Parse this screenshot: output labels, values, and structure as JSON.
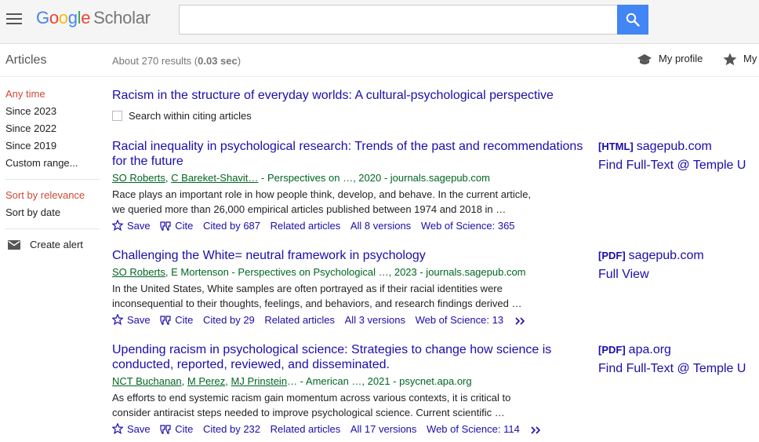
{
  "header": {
    "logo_letters": [
      "G",
      "o",
      "o",
      "g",
      "l",
      "e"
    ],
    "logo_product": "Scholar",
    "search_value": "",
    "colors": {
      "blue": "#4285f4",
      "red": "#ea4335",
      "yellow": "#fbbc05",
      "green": "#34a853"
    }
  },
  "subheader": {
    "section": "Articles",
    "results_prefix": "About 270 results (",
    "results_time": "0.03 sec",
    "results_suffix": ")",
    "my_profile": "My profile",
    "my_library": "My"
  },
  "sidebar": {
    "time_filters": [
      "Any time",
      "Since 2023",
      "Since 2022",
      "Since 2019",
      "Custom range..."
    ],
    "sort_options": [
      "Sort by relevance",
      "Sort by date"
    ],
    "create_alert": "Create alert",
    "active_color": "#d14836"
  },
  "cited": {
    "title": "Racism in the structure of everyday worlds: A cultural-psychological perspective",
    "search_within": "Search within citing articles"
  },
  "results": [
    {
      "title": "Racial inequality in psychological research: Trends of the past and recommendations for the future",
      "authors": [
        "SO Roberts",
        "C Bareket-Shavit…"
      ],
      "source": " - Perspectives on …, 2020 - journals.sagepub.com",
      "snippet": "Race plays an important role in how people think, develop, and behave. In the current article, we queried more than 26,000 empirical articles published between 1974 and 2018 in …",
      "save": "Save",
      "cite": "Cite",
      "cited_by": "Cited by 687",
      "related": "Related articles",
      "versions": "All 8 versions",
      "wos": "Web of Science: 365",
      "has_more": false,
      "side_type": "[HTML]",
      "side_domain": "sagepub.com",
      "side_extra": "Find Full-Text @ Temple U"
    },
    {
      "title": "Challenging the White= neutral framework in psychology",
      "authors": [
        "SO Roberts"
      ],
      "authors_plain": ", E Mortenson",
      "source": " - Perspectives on Psychological …, 2023 - journals.sagepub.com",
      "snippet": "In the United States, White samples are often portrayed as if their racial identities were inconsequential to their thoughts, feelings, and behaviors, and research findings derived …",
      "save": "Save",
      "cite": "Cite",
      "cited_by": "Cited by 29",
      "related": "Related articles",
      "versions": "All 3 versions",
      "wos": "Web of Science: 13",
      "has_more": true,
      "side_type": "[PDF]",
      "side_domain": "sagepub.com",
      "side_extra": "Full View"
    },
    {
      "title": "Upending racism in psychological science: Strategies to change how science is conducted, reported, reviewed, and disseminated.",
      "authors": [
        "NCT Buchanan",
        "M Perez",
        "MJ Prinstein"
      ],
      "source": "… - American …, 2021 - psycnet.apa.org",
      "snippet": "As efforts to end systemic racism gain momentum across various contexts, it is critical to consider antiracist steps needed to improve psychological science. Current scientific …",
      "save": "Save",
      "cite": "Cite",
      "cited_by": "Cited by 232",
      "related": "Related articles",
      "versions": "All 17 versions",
      "wos": "Web of Science: 114",
      "has_more": true,
      "side_type": "[PDF]",
      "side_domain": "apa.org",
      "side_extra": "Find Full-Text @ Temple U"
    }
  ]
}
